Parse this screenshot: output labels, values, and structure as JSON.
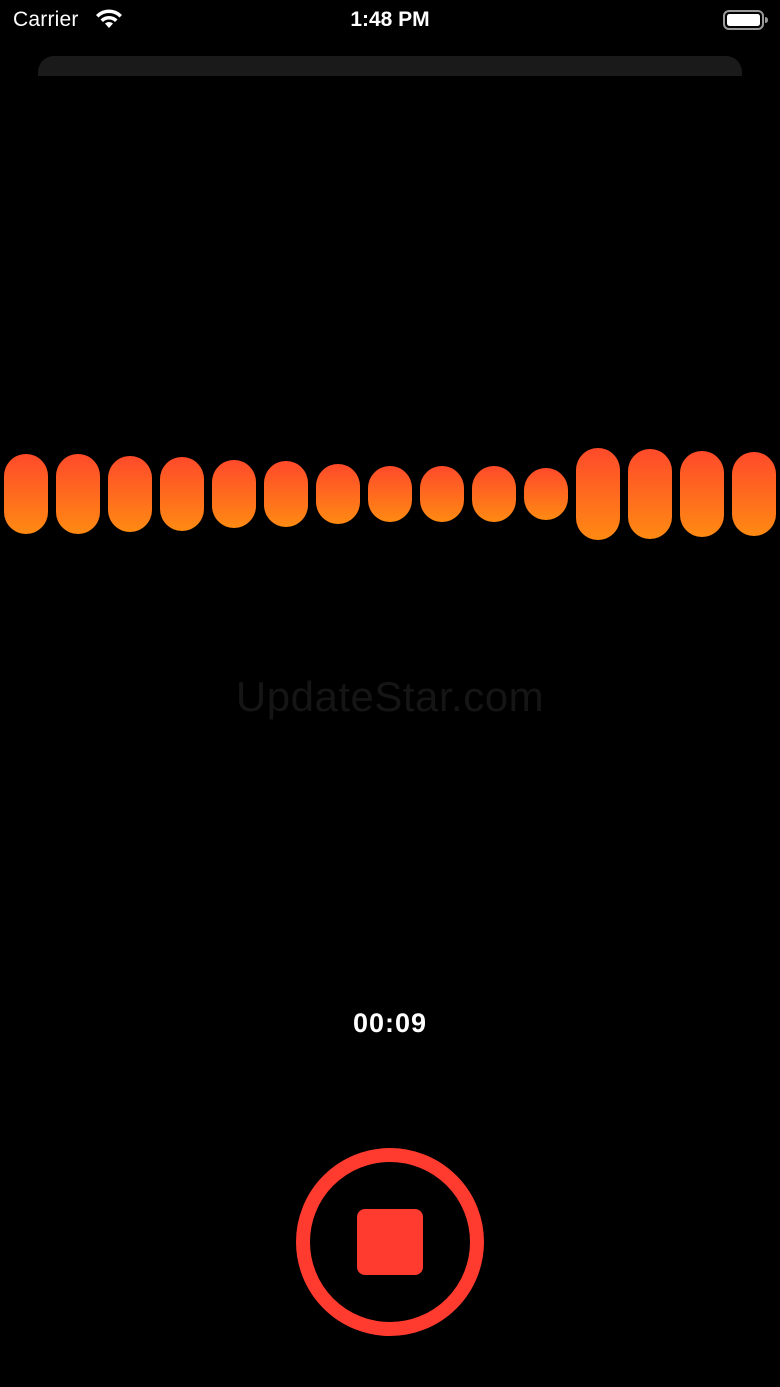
{
  "status_bar": {
    "carrier": "Carrier",
    "time": "1:48 PM",
    "wifi_icon": "wifi-icon",
    "battery_icon": "battery-icon",
    "battery_level": 1.0
  },
  "waveform": {
    "gradient_top": "#ff4a2b",
    "gradient_bottom": "#ff8a12",
    "levels": [
      0.86,
      0.86,
      0.83,
      0.8,
      0.74,
      0.71,
      0.66,
      0.6,
      0.6,
      0.6,
      0.57,
      1.0,
      0.97,
      0.94,
      0.91
    ]
  },
  "watermark": "UpdateStar.com",
  "timer": {
    "elapsed": "00:09"
  },
  "record_button": {
    "icon": "stop-icon",
    "color": "#ff3b30"
  }
}
